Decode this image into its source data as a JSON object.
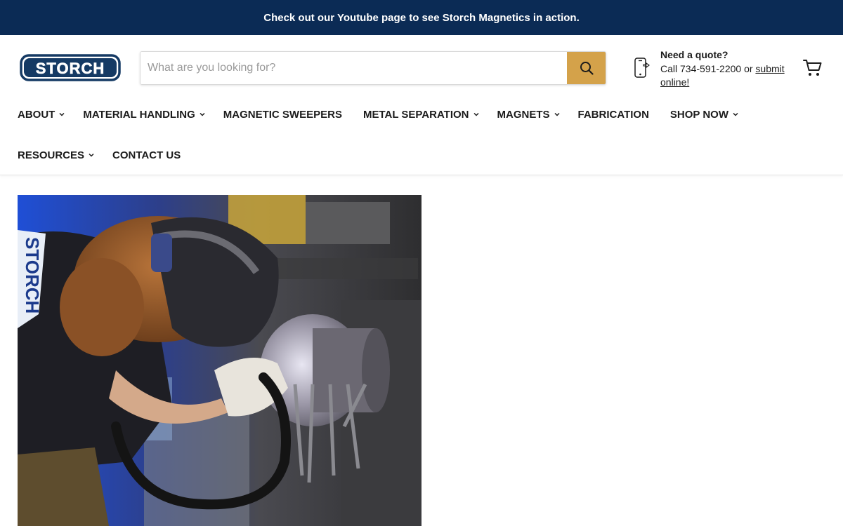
{
  "announcement": {
    "text": "Check out our Youtube page to see Storch Magnetics in action."
  },
  "header": {
    "logo_text": "STORCH",
    "search": {
      "placeholder": "What are you looking for?",
      "value": "",
      "button_icon": "search-icon"
    },
    "quote": {
      "title": "Need a quote?",
      "line_prefix": "Call 734-591-2200 or ",
      "link_text": "submit online!",
      "icon": "phone-icon"
    },
    "cart_icon": "cart-icon"
  },
  "nav": {
    "row1": [
      {
        "label": "ABOUT",
        "dropdown": true
      },
      {
        "label": "MATERIAL HANDLING",
        "dropdown": true
      },
      {
        "label": "MAGNETIC SWEEPERS",
        "dropdown": false
      },
      {
        "label": "METAL SEPARATION",
        "dropdown": true
      },
      {
        "label": "MAGNETS",
        "dropdown": true
      },
      {
        "label": "FABRICATION",
        "dropdown": false
      },
      {
        "label": "SHOP NOW",
        "dropdown": true
      }
    ],
    "row2": [
      {
        "label": "RESOURCES",
        "dropdown": true
      },
      {
        "label": "CONTACT US",
        "dropdown": false
      }
    ]
  },
  "hero": {
    "shirt_text": "STORCH"
  },
  "colors": {
    "announcement_bg": "#0b2b55",
    "search_button": "#d4a24a",
    "logo_navy": "#153a64"
  }
}
